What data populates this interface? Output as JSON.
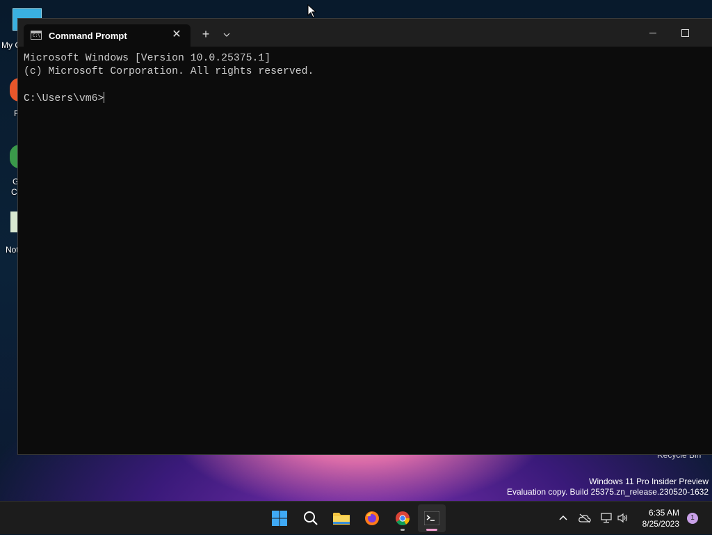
{
  "desktop": {
    "icons": [
      {
        "label": "My C"
      },
      {
        "label": "F"
      },
      {
        "label": "G"
      },
      {
        "label": "C"
      },
      {
        "label": "Not"
      }
    ],
    "recycle_bin_label": "Recycle Bin",
    "watermark_line1": "Windows 11 Pro Insider Preview",
    "watermark_line2": "Evaluation copy. Build 25375.zn_release.230520-1632"
  },
  "window": {
    "tab_title": "Command Prompt",
    "tab_icon_text": "C:\\",
    "close_tab_glyph": "✕",
    "new_tab_glyph": "+",
    "dropdown_glyph": "⌄",
    "console_lines": [
      "Microsoft Windows [Version 10.0.25375.1]",
      "(c) Microsoft Corporation. All rights reserved.",
      "",
      "C:\\Users\\vm6>"
    ]
  },
  "taskbar": {
    "apps": [
      {
        "name": "start"
      },
      {
        "name": "search"
      },
      {
        "name": "file-explorer"
      },
      {
        "name": "firefox"
      },
      {
        "name": "chrome"
      },
      {
        "name": "terminal"
      }
    ],
    "tray_chevron": "^",
    "time": "6:35 AM",
    "date": "8/25/2023",
    "notification_count": "1"
  },
  "colors": {
    "console_bg": "#0c0c0c",
    "console_text": "#cccccc",
    "taskbar_bg": "#1c1c1c",
    "active_pill": "#f0a0d0"
  }
}
